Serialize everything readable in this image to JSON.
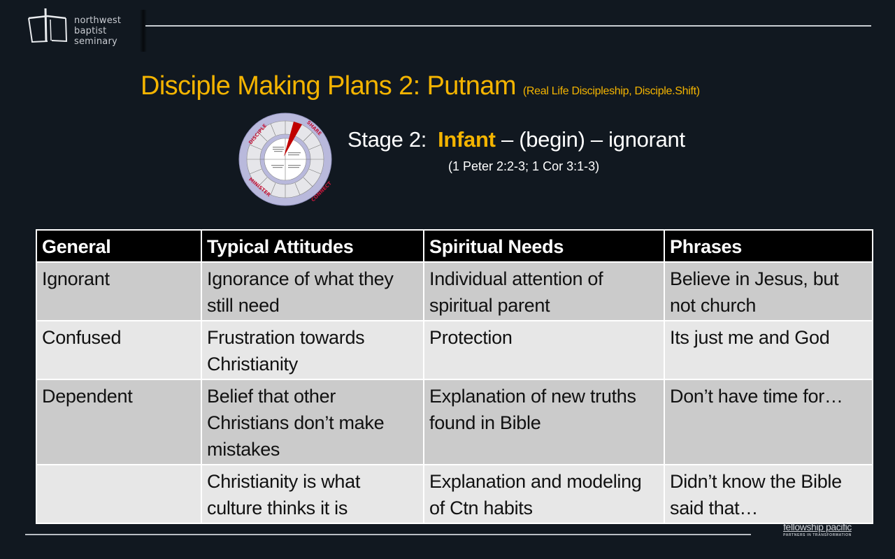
{
  "logo": {
    "icon": "seminary-cross-icon",
    "lines": [
      "northwest",
      "baptist",
      "seminary"
    ]
  },
  "title": {
    "main": "Disciple Making Plans 2: Putnam",
    "subtitle": "(Real Life Discipleship, Disciple.Shift)"
  },
  "wheel": {
    "icon": "discipleship-wheel-diagram",
    "quadrants": [
      "DISCIPLE",
      "SHARE",
      "CONNECT",
      "MINISTER"
    ],
    "colors": {
      "ring": "#b9b9dc",
      "pointer": "#c00000",
      "quadrant_text": "#c4183c"
    }
  },
  "stage": {
    "label": "Stage 2:",
    "name": "Infant",
    "rest": " – (begin) – ignorant",
    "refs": "(1 Peter 2:2-3; 1 Cor 3:1-3)"
  },
  "table": {
    "headers": [
      "General",
      "Typical Attitudes",
      "Spiritual Needs",
      "Phrases"
    ],
    "rows": [
      [
        "Ignorant",
        "Ignorance of what they still need",
        "Individual attention of spiritual parent",
        "Believe in Jesus, but not church"
      ],
      [
        "Confused",
        "Frustration towards Christianity",
        "Protection",
        "Its just me and God"
      ],
      [
        "Dependent",
        "Belief that other Christians don’t make mistakes",
        "Explanation of new truths found in Bible",
        "Don’t have time for…"
      ],
      [
        "",
        "Christianity is what culture thinks it is",
        "Explanation and modeling of Ctn habits",
        "Didn’t know the Bible said that…"
      ]
    ]
  },
  "footer": {
    "partner_name": "fellowship pacific",
    "partner_tagline": "PARTNERS IN TRANSFORMATION"
  },
  "colors": {
    "background": "#111820",
    "accent": "#f4b400",
    "header_bg": "#000000",
    "row_dark": "#cbcbcb",
    "row_light": "#e7e7e7"
  }
}
